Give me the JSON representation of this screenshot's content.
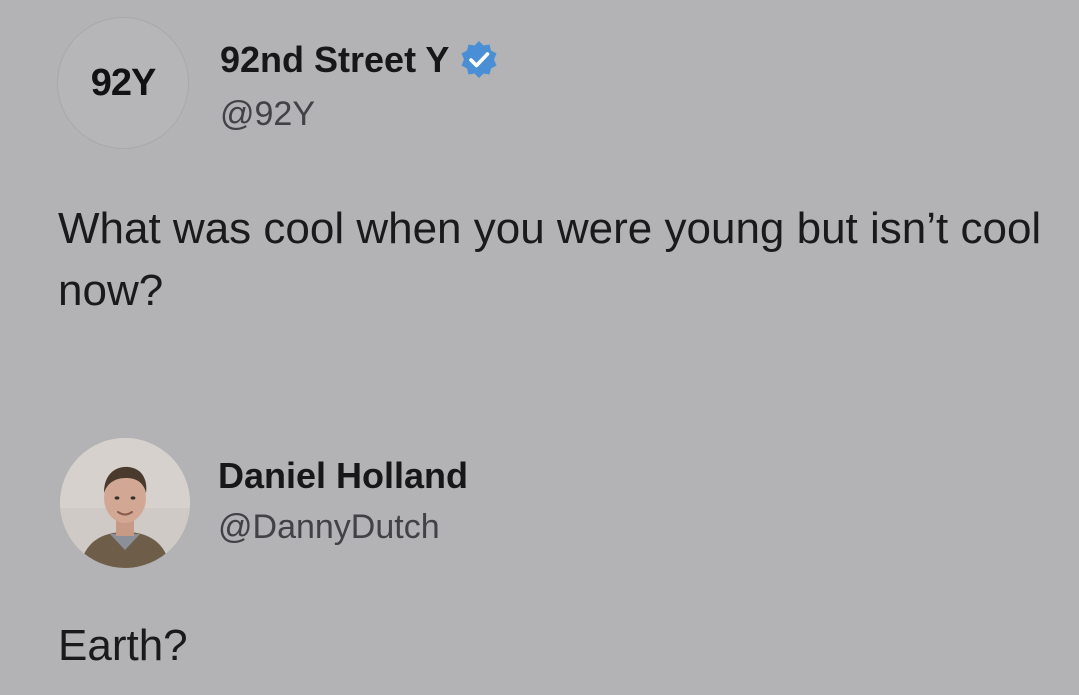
{
  "original": {
    "avatar_text": "92Y",
    "display_name": "92nd Street Y",
    "handle": "@92Y",
    "verified_icon": "verified-badge-icon",
    "text": "What was cool when you were young but isn’t cool now?"
  },
  "reply": {
    "display_name": "Daniel Holland",
    "handle": "@DannyDutch",
    "text": "Earth?"
  },
  "colors": {
    "background": "#b3b2b4",
    "verified_blue": "#4a8fd6",
    "text": "#1a1a1c",
    "handle": "#424246"
  }
}
